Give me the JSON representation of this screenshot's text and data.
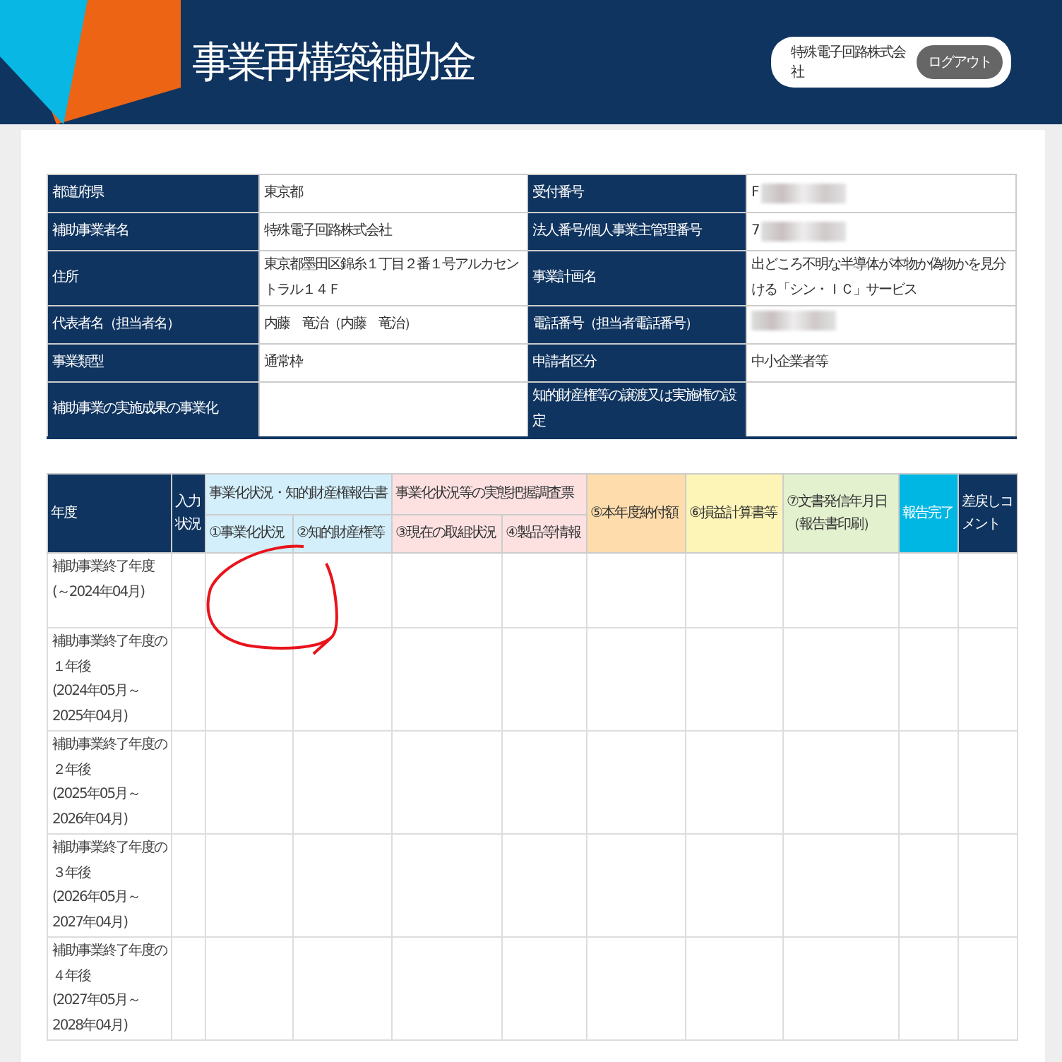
{
  "header": {
    "title": "事業再構築補助金",
    "user": "特殊電子回路株式会社",
    "logout": "ログアウト"
  },
  "info": [
    {
      "label": "都道府県",
      "value": "東京都",
      "label2": "受付番号",
      "value2": "F",
      "redacted2": true
    },
    {
      "label": "補助事業者名",
      "value": "特殊電子回路株式会社",
      "label2": "法人番号/個人事業主管理番号",
      "value2": "7",
      "redacted2": true
    },
    {
      "label": "住所",
      "value": "東京都墨田区錦糸１丁目２番１号アルカセントラル１４Ｆ",
      "label2": "事業計画名",
      "value2": "出どころ不明な半導体が本物か偽物かを見分ける「シン・ＩＣ」サービス"
    },
    {
      "label": "代表者名（担当者名）",
      "value": "内藤　竜治（内藤　竜治）",
      "label2": "電話番号（担当者電話番号）",
      "redacted2": true
    },
    {
      "label": "事業類型",
      "value": "通常枠",
      "label2": "申請者区分",
      "value2": "中小企業者等"
    },
    {
      "label": "補助事業の実施成果の事業化",
      "label2": "知的財産権等の譲渡又は実施権の設定"
    }
  ],
  "report": {
    "columns": [
      {
        "label": "年度",
        "color": "#0f3460"
      },
      {
        "label": "入力状況",
        "color": "#0f3460"
      },
      {
        "label": "事業化状況・知的財産権報告書",
        "color": "#d3effb",
        "sub": [
          "①事業化状況",
          "②知的財産権等"
        ]
      },
      {
        "label": "事業化状況等の実態把握調査票",
        "color": "#fde1e1",
        "sub": [
          "③現在の取組状況",
          "④製品等情報"
        ]
      },
      {
        "label": "⑤本年度納付額",
        "color": "#ffdcab"
      },
      {
        "label": "⑥損益計算書等",
        "color": "#fdf4b8"
      },
      {
        "label": "⑦文書発信年月日（報告書印刷）",
        "color": "#e3f1cf"
      },
      {
        "label": "報告完了",
        "color": "#00b6e2"
      },
      {
        "label": "差戻しコメント",
        "color": "#0f3460"
      }
    ],
    "rows": [
      {
        "year": "補助事業終了年度",
        "period": "(～2024年04月)"
      },
      {
        "year": "補助事業終了年度の１年後",
        "period": "(2024年05月～2025年04月)"
      },
      {
        "year": "補助事業終了年度の２年後",
        "period": "(2025年05月～2026年04月)"
      },
      {
        "year": "補助事業終了年度の３年後",
        "period": "(2026年05月～2027年04月)"
      },
      {
        "year": "補助事業終了年度の４年後",
        "period": "(2027年05月～2028年04月)"
      }
    ]
  }
}
